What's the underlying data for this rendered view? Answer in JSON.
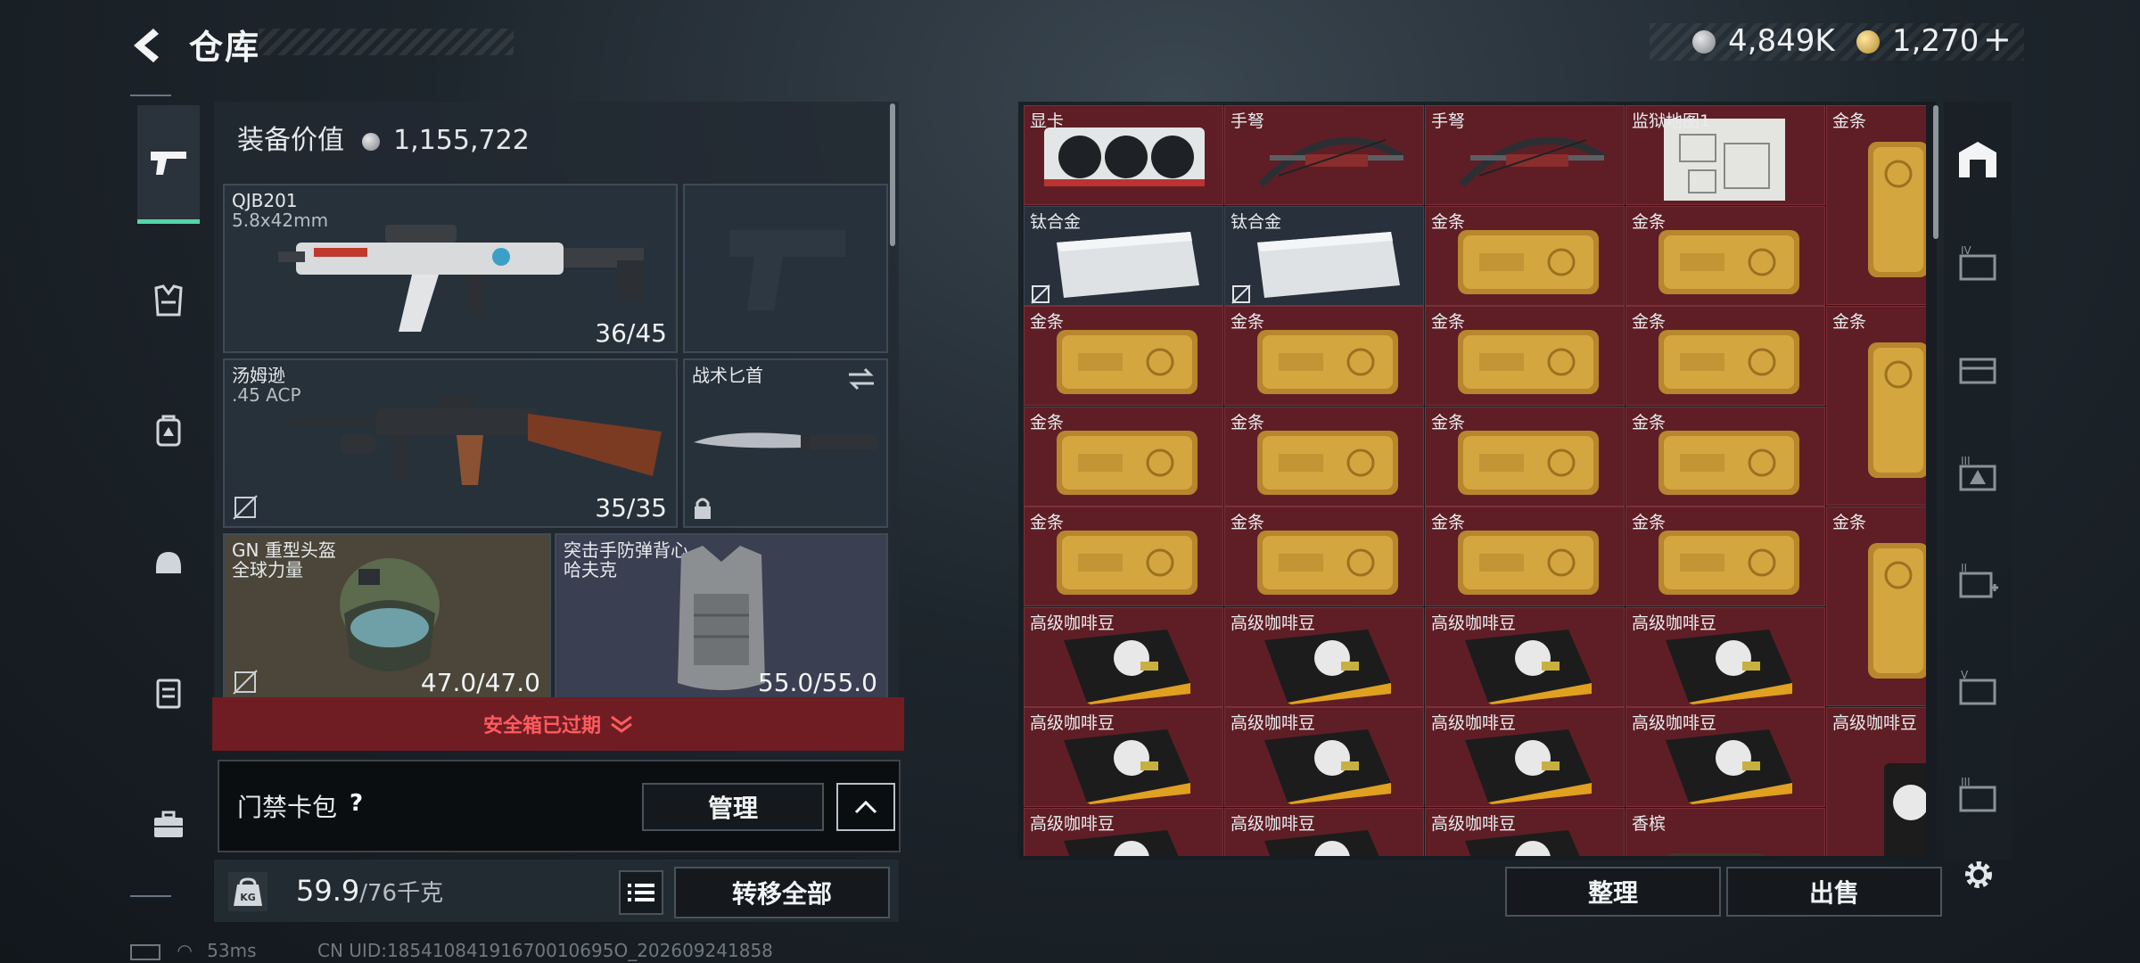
{
  "header": {
    "title": "仓库"
  },
  "currency": {
    "silver": "4,849K",
    "gold": "1,270",
    "plus": "+"
  },
  "equipment": {
    "value_label": "装备价值",
    "value": "1,155,722",
    "slots": [
      {
        "name": "QJB201",
        "sub": "5.8x42mm",
        "value": "36/45"
      },
      {
        "name": "汤姆逊",
        "sub": ".45 ACP",
        "value": "35/35"
      },
      {
        "name": "战术匕首",
        "sub": "",
        "value": ""
      },
      {
        "name": "GN 重型头盔",
        "sub": "全球力量",
        "value": "47.0/47.0"
      },
      {
        "name": "突击手防弹背心",
        "sub": "哈夫克",
        "value": "55.0/55.0"
      }
    ]
  },
  "safebox": {
    "text": "安全箱已过期"
  },
  "card_pack": {
    "label": "门禁卡包",
    "help": "?",
    "manage": "管理"
  },
  "weight": {
    "current": "59.9",
    "max": "/76千克"
  },
  "actions": {
    "transfer_all": "转移全部",
    "sort": "整理",
    "sell": "出售"
  },
  "status": {
    "ping": "53ms",
    "uid": "CN UID:18541084191670010695О_202609241858"
  },
  "storage": {
    "items": [
      {
        "name": "显卡",
        "kind": "gpu"
      },
      {
        "name": "手弩",
        "kind": "crossbow"
      },
      {
        "name": "手弩",
        "kind": "crossbow"
      },
      {
        "name": "监狱地图1",
        "kind": "map"
      },
      {
        "name": "金条",
        "kind": "gold-v"
      },
      {
        "name": "钛合金",
        "kind": "titanium"
      },
      {
        "name": "钛合金",
        "kind": "titanium"
      },
      {
        "name": "金条",
        "kind": "gold"
      },
      {
        "name": "金条",
        "kind": "gold"
      },
      {
        "name": "金条",
        "kind": "gold"
      },
      {
        "name": "金条",
        "kind": "gold"
      },
      {
        "name": "金条",
        "kind": "gold"
      },
      {
        "name": "金条",
        "kind": "gold"
      },
      {
        "name": "金条",
        "kind": "gold-v"
      },
      {
        "name": "金条",
        "kind": "gold"
      },
      {
        "name": "金条",
        "kind": "gold"
      },
      {
        "name": "金条",
        "kind": "gold"
      },
      {
        "name": "金条",
        "kind": "gold"
      },
      {
        "name": "金条",
        "kind": "gold"
      },
      {
        "name": "金条",
        "kind": "gold"
      },
      {
        "name": "金条",
        "kind": "gold"
      },
      {
        "name": "金条",
        "kind": "gold"
      },
      {
        "name": "金条",
        "kind": "gold-v"
      },
      {
        "name": "高级咖啡豆",
        "kind": "coffee"
      },
      {
        "name": "高级咖啡豆",
        "kind": "coffee"
      },
      {
        "name": "高级咖啡豆",
        "kind": "coffee"
      },
      {
        "name": "高级咖啡豆",
        "kind": "coffee"
      },
      {
        "name": "高级咖啡豆",
        "kind": "coffee"
      },
      {
        "name": "高级咖啡豆",
        "kind": "coffee"
      },
      {
        "name": "高级咖啡豆",
        "kind": "coffee"
      },
      {
        "name": "高级咖啡豆",
        "kind": "coffee"
      },
      {
        "name": "高级咖啡豆",
        "kind": "coffee-v"
      },
      {
        "name": "高级咖啡豆",
        "kind": "coffee"
      },
      {
        "name": "高级咖啡豆",
        "kind": "coffee"
      },
      {
        "name": "高级咖啡豆",
        "kind": "coffee"
      },
      {
        "name": "香槟",
        "kind": "champagne"
      }
    ]
  },
  "right_nav": [
    "warehouse-icon",
    "storage-iv-icon",
    "storage-icon",
    "storage-iii-icon",
    "add-storage-ii-icon",
    "storage-v-icon",
    "storage-iii-b-icon"
  ],
  "colors": {
    "accent": "#55d6a8",
    "cell_red": "#5f1e25",
    "alert": "#ff5b5f",
    "gold": "#d4a640"
  }
}
